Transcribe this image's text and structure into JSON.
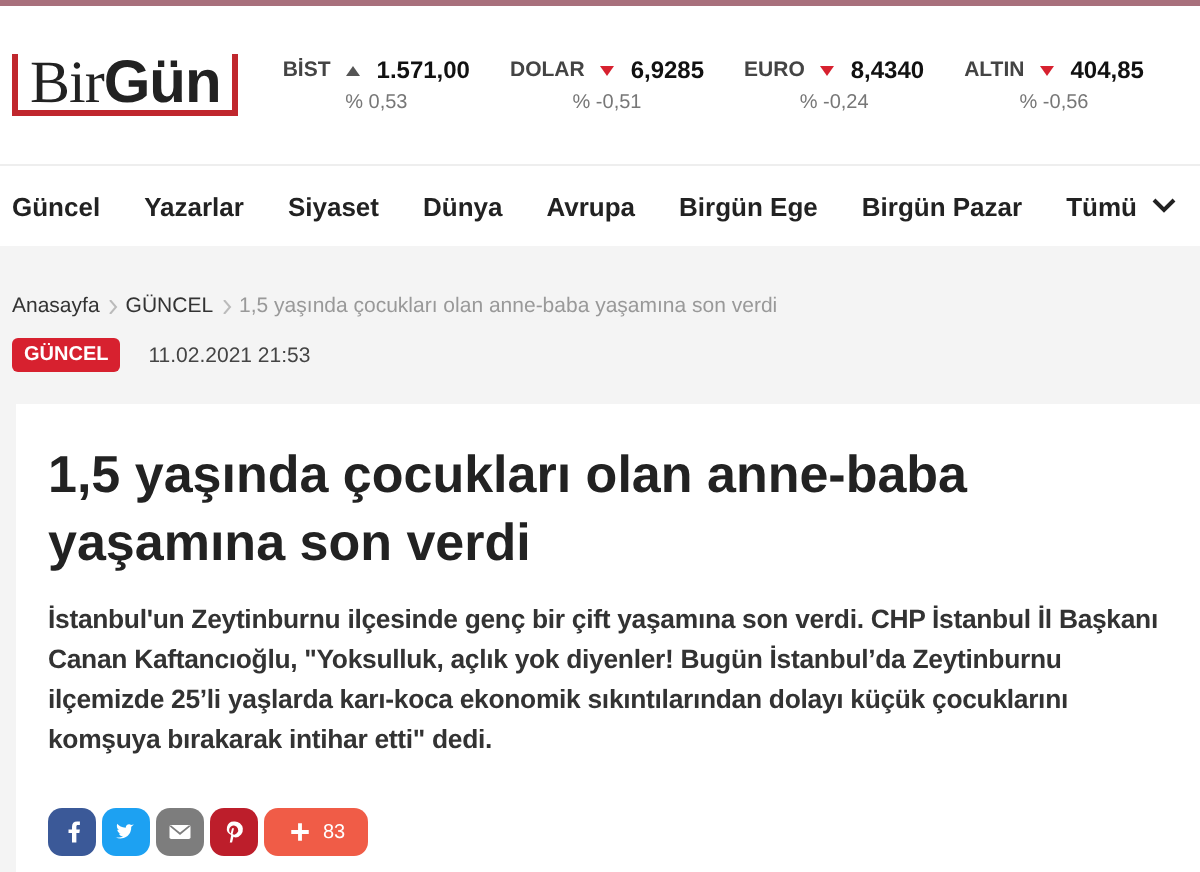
{
  "logo": "Bir**Gün**",
  "tickers": [
    {
      "name": "BİST",
      "rising": true,
      "value": "1.571,00",
      "change": "% 0,53"
    },
    {
      "name": "DOLAR",
      "rising": false,
      "value": "6,9285",
      "change": "% -0,51"
    },
    {
      "name": "EURO",
      "rising": false,
      "value": "8,4340",
      "change": "% -0,24"
    },
    {
      "name": "ALTIN",
      "rising": false,
      "value": "404,85",
      "change": "% -0,56"
    }
  ],
  "nav": [
    "Güncel",
    "Yazarlar",
    "Siyaset",
    "Dünya",
    "Avrupa",
    "Birgün Ege",
    "Birgün Pazar"
  ],
  "nav_more": "Tümü",
  "breadcrumb": [
    "Anasayfa",
    "GÜNCEL",
    "1,5 yaşında çocukları olan anne-baba yaşamına son verdi"
  ],
  "category": "GÜNCEL",
  "date": "11.02.2021 21:53",
  "title": "1,5 yaşında çocukları olan anne-baba yaşamına son verdi",
  "summary": "İstanbul'un Zeytinburnu ilçesinde genç bir çift yaşamına son verdi. CHP İstanbul İl Başkanı Canan Kaftancıoğlu, \"Yoksulluk, açlık yok diyenler! Bugün İstanbul’da Zeytinburnu ilçemizde 25’li yaşlarda karı-koca ekonomik sıkıntılarından dolayı küçük çocuklarını komşuya bırakarak intihar etti\" dedi.",
  "share": [
    {
      "kind": "facebook"
    },
    {
      "kind": "twitter"
    },
    {
      "kind": "mail"
    },
    {
      "kind": "pinterest"
    },
    {
      "kind": "more",
      "count": "83"
    }
  ]
}
